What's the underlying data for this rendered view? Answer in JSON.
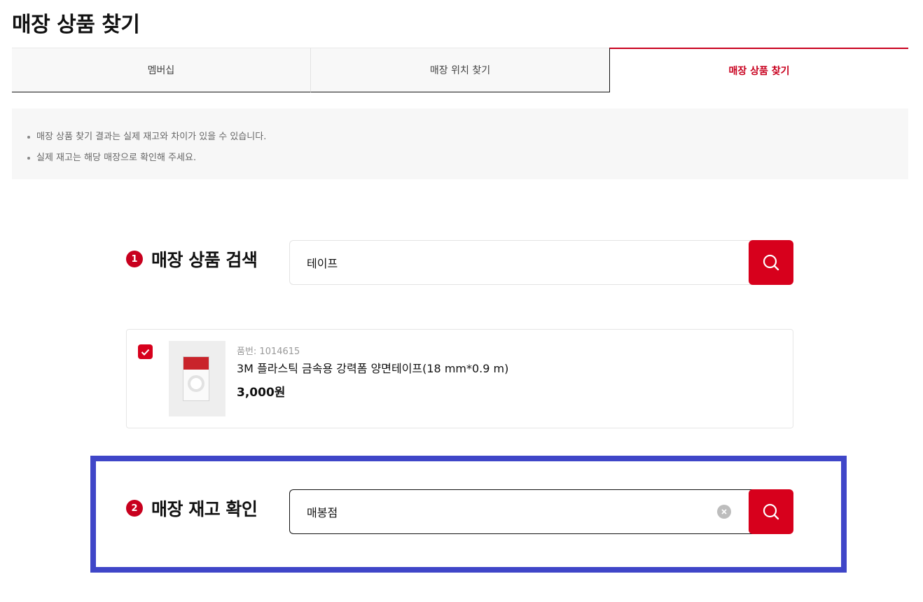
{
  "page": {
    "title": "매장 상품 찾기"
  },
  "tabs": [
    {
      "label": "멤버십"
    },
    {
      "label": "매장 위치 찾기"
    },
    {
      "label": "매장 상품 찾기",
      "active": true
    }
  ],
  "notice": {
    "lines": [
      "매장 상품 찾기 결과는 실제 재고와 차이가 있을 수 있습니다.",
      "실제 재고는 해당 매장으로 확인해 주세요."
    ]
  },
  "step1": {
    "number": "1",
    "label": "매장 상품 검색",
    "value": "테이프",
    "icon": "search-icon"
  },
  "product": {
    "checked": true,
    "code": "품번: 1014615",
    "name": "3M 플라스틱 금속용 강력폼 양면테이프(18 mm*0.9 m)",
    "price": "3,000원"
  },
  "step2": {
    "number": "2",
    "label": "매장 재고 확인",
    "value": "매봉점",
    "clear_icon": "close-icon",
    "icon": "search-icon"
  },
  "colors": {
    "accent": "#d7001c",
    "active_tab": "#c8001e",
    "highlight": "#3f46c8"
  }
}
